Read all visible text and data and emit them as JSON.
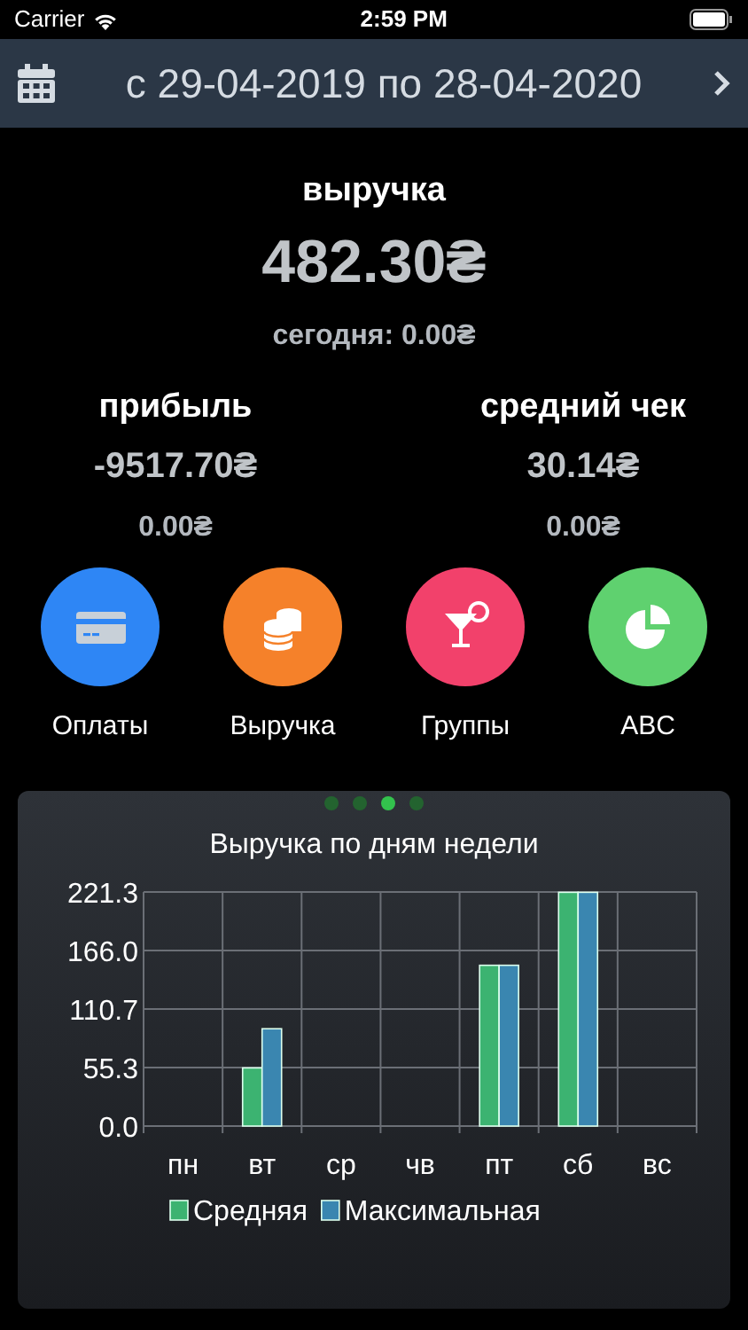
{
  "status_bar": {
    "carrier": "Carrier",
    "time": "2:59 PM"
  },
  "period": {
    "label": "с 29-04-2019 по 28-04-2020"
  },
  "revenue": {
    "title": "выручка",
    "value": "482.30₴",
    "today": "сегодня: 0.00₴"
  },
  "metrics": [
    {
      "title": "прибыль",
      "value": "-9517.70₴",
      "today": "0.00₴"
    },
    {
      "title": "средний чек",
      "value": "30.14₴",
      "today": "0.00₴"
    }
  ],
  "shortcuts": [
    {
      "kind": "card",
      "label": "Оплаты",
      "color": "#2e86f5"
    },
    {
      "kind": "coins",
      "label": "Выручка",
      "color": "#f5812a"
    },
    {
      "kind": "cocktail",
      "label": "Группы",
      "color": "#f2416b"
    },
    {
      "kind": "pie",
      "label": "ABC",
      "color": "#5fd16f"
    }
  ],
  "pager": [
    {
      "selected": false
    },
    {
      "selected": false
    },
    {
      "selected": true
    },
    {
      "selected": false
    }
  ],
  "chart_data": {
    "type": "bar",
    "title": "Выручка по дням недели",
    "categories": [
      "пн",
      "вт",
      "ср",
      "чв",
      "пт",
      "сб",
      "вс"
    ],
    "series": [
      {
        "name": "Средняя",
        "color": "#3cb371",
        "values": [
          0,
          55,
          0,
          0,
          152,
          221,
          0
        ]
      },
      {
        "name": "Максимальная",
        "color": "#3a86b0",
        "values": [
          0,
          92,
          0,
          0,
          152,
          221,
          0
        ]
      }
    ],
    "ylim": [
      0,
      221.3
    ],
    "yticks": [
      {
        "value": 0,
        "label": "0.0"
      },
      55.3,
      110.7,
      {
        "value": 166,
        "label": "166.0"
      },
      221.3
    ],
    "grid": true,
    "legend": true
  }
}
